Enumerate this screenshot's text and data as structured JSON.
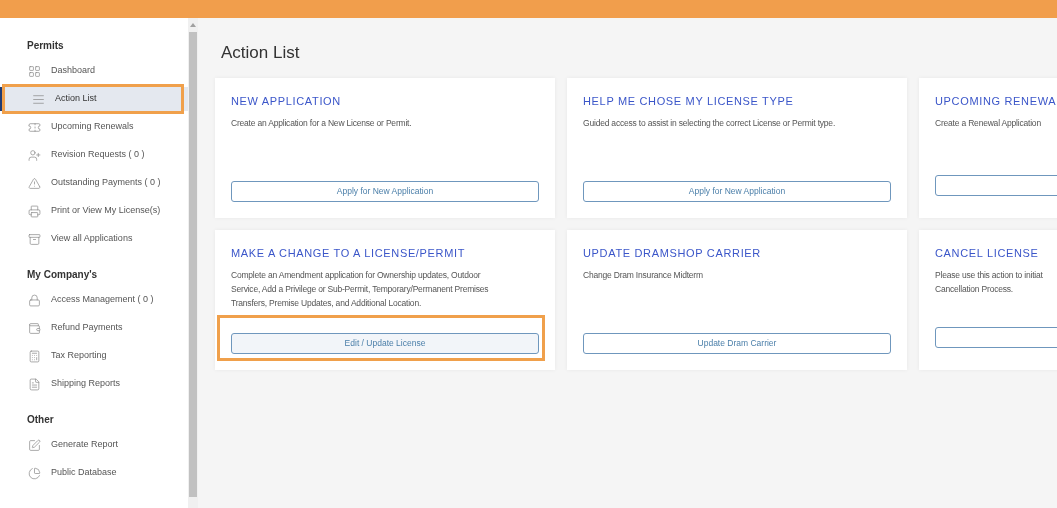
{
  "sidebar": {
    "sections": [
      {
        "title": "Permits",
        "items": [
          {
            "label": "Dashboard",
            "selected": false,
            "highlighted": false
          },
          {
            "label": "Action List",
            "selected": true,
            "highlighted": true
          },
          {
            "label": "Upcoming Renewals",
            "selected": false,
            "highlighted": false
          },
          {
            "label": "Revision Requests ( 0 )",
            "selected": false,
            "highlighted": false
          },
          {
            "label": "Outstanding Payments ( 0 )",
            "selected": false,
            "highlighted": false
          },
          {
            "label": "Print or View My License(s)",
            "selected": false,
            "highlighted": false
          },
          {
            "label": "View all Applications",
            "selected": false,
            "highlighted": false
          }
        ]
      },
      {
        "title": "My Company's",
        "items": [
          {
            "label": "Access Management ( 0 )",
            "selected": false,
            "highlighted": false
          },
          {
            "label": "Refund Payments",
            "selected": false,
            "highlighted": false
          },
          {
            "label": "Tax Reporting",
            "selected": false,
            "highlighted": false
          },
          {
            "label": "Shipping Reports",
            "selected": false,
            "highlighted": false
          }
        ]
      },
      {
        "title": "Other",
        "items": [
          {
            "label": "Generate Report",
            "selected": false,
            "highlighted": false
          },
          {
            "label": "Public Database",
            "selected": false,
            "highlighted": false
          }
        ]
      }
    ]
  },
  "page_title": "Action List",
  "cards": [
    {
      "title": "NEW APPLICATION",
      "description": [
        "Create an Application for a New License or Permit."
      ],
      "button": "Apply for New Application",
      "highlighted": false
    },
    {
      "title": "HELP ME CHOSE MY LICENSE TYPE",
      "description": [
        "Guided access to assist in selecting the correct License or Permit type."
      ],
      "button": "Apply for New Application",
      "highlighted": false
    },
    {
      "title": "UPCOMING RENEWA",
      "description": [
        "Create a Renewal Application"
      ],
      "highlighted": false
    },
    {
      "title": "MAKE A CHANGE TO A LICENSE/PERMIT",
      "description": [
        "Complete an Amendment application for Ownership updates, Outdoor",
        "Service, Add a Privilege or Sub-Permit, Temporary/Permanent Premises",
        "Transfers, Premise Updates, and Additional Location."
      ],
      "button": "Edit / Update License",
      "highlighted": true
    },
    {
      "title": "UPDATE DRAMSHOP CARRIER",
      "description": [
        "Change Dram Insurance Midterm"
      ],
      "button": "Update Dram Carrier",
      "highlighted": false
    },
    {
      "title": "CANCEL LICENSE",
      "description": [
        "Please use this action to initiat",
        "Cancellation Process."
      ],
      "highlighted": false
    }
  ]
}
